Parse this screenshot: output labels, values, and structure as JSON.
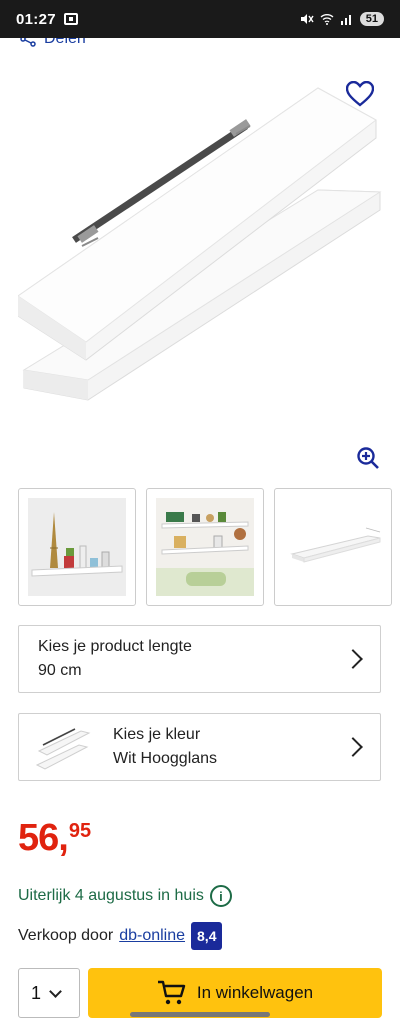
{
  "status_bar": {
    "time": "01:27",
    "battery": "51"
  },
  "share": {
    "label": "Delen"
  },
  "hero": {
    "favorite_icon": "heart-icon",
    "zoom_icon": "zoom-in-icon"
  },
  "thumbnails": [
    {
      "name": "thumbnail-eiffel-shelf"
    },
    {
      "name": "thumbnail-living-room-shelves"
    },
    {
      "name": "thumbnail-single-shelf"
    }
  ],
  "length_option": {
    "title": "Kies je product lengte",
    "value": "90 cm"
  },
  "color_option": {
    "title": "Kies je kleur",
    "value": "Wit Hoogglans"
  },
  "price": {
    "euros": "56",
    "comma": ",",
    "cents": "95",
    "color": "#e0230f"
  },
  "delivery": {
    "text": "Uiterlijk 4 augustus in huis",
    "info_icon": "i"
  },
  "seller": {
    "prefix": "Verkoop door",
    "name": "db-online",
    "rating": "8,4"
  },
  "cart": {
    "quantity": "1",
    "button_label": "In winkelwagen",
    "button_color": "#ffc20e"
  }
}
